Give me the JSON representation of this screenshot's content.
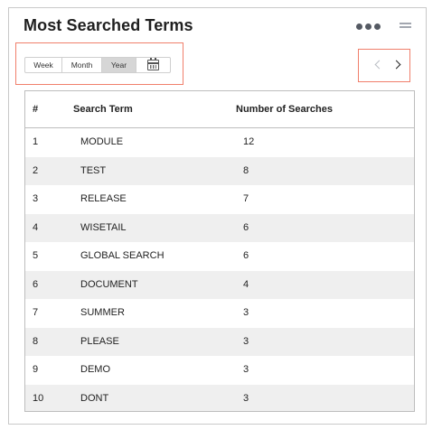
{
  "widget": {
    "title": "Most Searched Terms"
  },
  "filters": {
    "options": [
      "Week",
      "Month",
      "Year"
    ],
    "selected": "Year"
  },
  "table": {
    "headers": {
      "rank": "#",
      "term": "Search Term",
      "count": "Number of Searches"
    },
    "rows": [
      {
        "rank": "1",
        "term": "MODULE",
        "count": "12"
      },
      {
        "rank": "2",
        "term": "TEST",
        "count": "8"
      },
      {
        "rank": "3",
        "term": "RELEASE",
        "count": "7"
      },
      {
        "rank": "4",
        "term": "WISETAIL",
        "count": "6"
      },
      {
        "rank": "5",
        "term": "GLOBAL SEARCH",
        "count": "6"
      },
      {
        "rank": "6",
        "term": "DOCUMENT",
        "count": "4"
      },
      {
        "rank": "7",
        "term": "SUMMER",
        "count": "3"
      },
      {
        "rank": "8",
        "term": "PLEASE",
        "count": "3"
      },
      {
        "rank": "9",
        "term": "DEMO",
        "count": "3"
      },
      {
        "rank": "10",
        "term": "DONT",
        "count": "3"
      }
    ]
  },
  "icons": {
    "more": "more-dots-icon",
    "menu": "hamburger-icon",
    "calendar": "calendar-icon",
    "prev": "chevron-left-icon",
    "next": "chevron-right-icon"
  },
  "colors": {
    "highlight_border": "#f07f6b",
    "selected_segment": "#d6d6d6",
    "zebra_row": "#efefef"
  }
}
